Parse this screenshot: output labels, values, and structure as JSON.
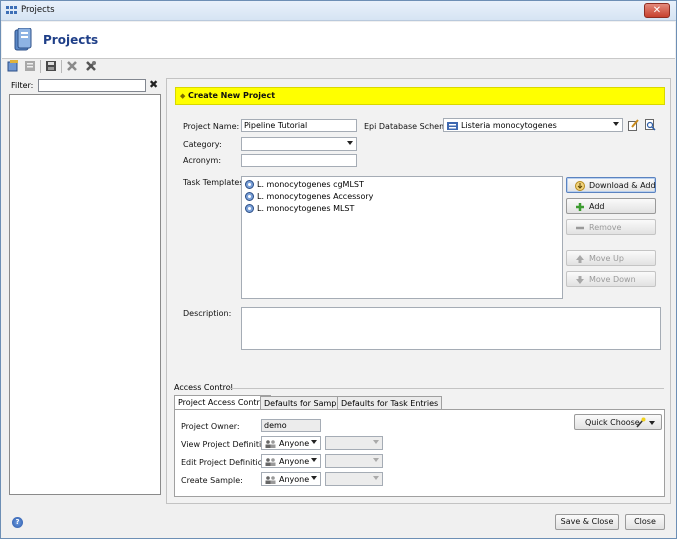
{
  "window": {
    "title": "Projects",
    "close_glyph": "✕"
  },
  "header": {
    "title": "Projects"
  },
  "toolbar": {
    "icons": [
      "new-project-icon",
      "edit-icon",
      "save-icon",
      "delete-icon",
      "settings-icon"
    ]
  },
  "filter": {
    "label": "Filter:",
    "value": "",
    "clear_glyph": "✖"
  },
  "form": {
    "banner_bullet": "◆",
    "banner_title": "Create New Project",
    "project_name_label": "Project Name:",
    "project_name_value": "Pipeline Tutorial",
    "epi_label": "Epi Database Scheme:",
    "epi_value": "Listeria monocytogenes",
    "category_label": "Category:",
    "category_value": "",
    "acronym_label": "Acronym:",
    "acronym_value": "",
    "task_templates_label": "Task Templates:",
    "task_templates": [
      "L. monocytogenes cgMLST",
      "L. monocytogenes Accessory",
      "L. monocytogenes MLST"
    ],
    "description_label": "Description:",
    "description_value": ""
  },
  "template_buttons": {
    "download_add": "Download & Add",
    "add": "Add",
    "remove": "Remove",
    "move_up": "Move Up",
    "move_down": "Move Down"
  },
  "access_control": {
    "section_title": "Access Control",
    "tabs": [
      "Project Access Control",
      "Defaults for Samples",
      "Defaults for Task Entries"
    ],
    "active_tab": "Project Access Control",
    "quick_choose": "Quick Choose",
    "owner_label": "Project Owner:",
    "owner_value": "demo",
    "rows": [
      {
        "label": "View Project Definition:",
        "value": "Anyone"
      },
      {
        "label": "Edit Project Definition:",
        "value": "Anyone"
      },
      {
        "label": "Create Sample:",
        "value": "Anyone"
      }
    ]
  },
  "footer": {
    "save_close": "Save & Close",
    "close": "Close",
    "help_glyph": "?"
  },
  "colors": {
    "banner": "#ffff00",
    "header_title": "#1f3f88",
    "close_button": "#c7412e"
  }
}
